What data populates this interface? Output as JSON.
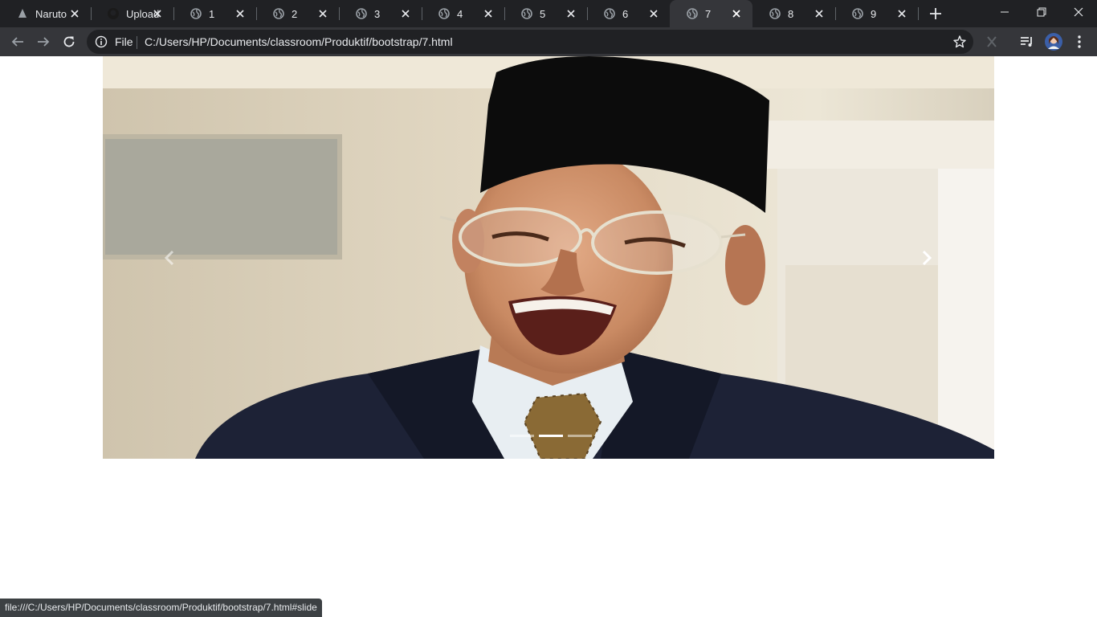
{
  "browser": {
    "tabs": [
      {
        "title": "Naruto",
        "icon": "document-icon"
      },
      {
        "title": "Upload",
        "icon": "github-icon"
      },
      {
        "title": "1",
        "icon": "globe-icon"
      },
      {
        "title": "2",
        "icon": "globe-icon"
      },
      {
        "title": "3",
        "icon": "globe-icon"
      },
      {
        "title": "4",
        "icon": "globe-icon"
      },
      {
        "title": "5",
        "icon": "globe-icon"
      },
      {
        "title": "6",
        "icon": "globe-icon"
      },
      {
        "title": "7",
        "icon": "globe-icon",
        "active": true
      },
      {
        "title": "8",
        "icon": "globe-icon"
      },
      {
        "title": "9",
        "icon": "globe-icon"
      }
    ],
    "address": {
      "scheme_label": "File",
      "url": "C:/Users/HP/Documents/classroom/Produktif/bootstrap/7.html"
    }
  },
  "carousel": {
    "slide_count": 3,
    "active_index": 1
  },
  "status_bar": {
    "text": "file:///C:/Users/HP/Documents/classroom/Produktif/bootstrap/7.html#slide"
  },
  "colors": {
    "tabstrip": "#202124",
    "toolbar": "#35363a",
    "text": "#e8eaed"
  }
}
